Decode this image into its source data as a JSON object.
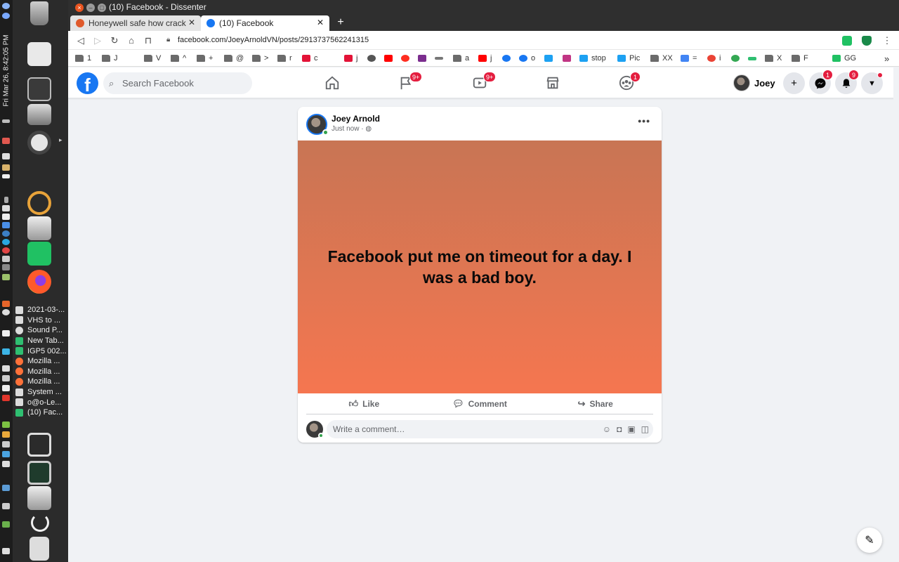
{
  "system": {
    "clock": "Fri Mar 26, 8:42:05 PM"
  },
  "dock": {
    "windows": [
      {
        "label": "2021-03-...",
        "color": "#d9d9d9"
      },
      {
        "label": "VHS to ...",
        "color": "#d9d9d9"
      },
      {
        "label": "Sound P...",
        "color": "#d9d9d9"
      },
      {
        "label": "New Tab...",
        "color": "#2fbf71"
      },
      {
        "label": "IGP5 002...",
        "color": "#2fbf71"
      },
      {
        "label": "Mozilla ...",
        "color": "#ff7139"
      },
      {
        "label": "Mozilla ...",
        "color": "#ff7139"
      },
      {
        "label": "Mozilla ...",
        "color": "#ff7139"
      },
      {
        "label": "System ...",
        "color": "#d9d9d9"
      },
      {
        "label": "o@o-Le...",
        "color": "#d9d9d9"
      },
      {
        "label": "(10) Fac...",
        "color": "#2fbf71"
      }
    ]
  },
  "browser": {
    "window_title": "(10) Facebook - Dissenter",
    "tabs": [
      {
        "label": "Honeywell safe how crack",
        "favicon_color": "#e05a2b"
      },
      {
        "label": "(10) Facebook",
        "favicon_color": "#1877f2"
      }
    ],
    "new_tab_label": "+",
    "url": "facebook.com/JoeyArnoldVN/posts/2913737562241315",
    "bookmarks": [
      {
        "label": "1",
        "icon": "folder"
      },
      {
        "label": "J",
        "icon": "folder"
      },
      {
        "label": "V",
        "icon": "folder"
      },
      {
        "label": "^",
        "icon": "folder"
      },
      {
        "label": "+",
        "icon": "folder"
      },
      {
        "label": "@",
        "icon": "folder"
      },
      {
        "label": ">",
        "icon": "folder"
      },
      {
        "label": "r",
        "icon": "folder"
      },
      {
        "label": "c",
        "icon": "hive"
      },
      {
        "label": "j",
        "icon": "hive"
      },
      {
        "label": "",
        "icon": "globe"
      },
      {
        "label": "",
        "icon": "youtube"
      },
      {
        "label": "",
        "icon": "brave"
      },
      {
        "label": "",
        "icon": "play"
      },
      {
        "label": "",
        "icon": "bar"
      },
      {
        "label": "a",
        "icon": "folder"
      },
      {
        "label": "j",
        "icon": "youtube"
      },
      {
        "label": "",
        "icon": "facebook"
      },
      {
        "label": "o",
        "icon": "facebook"
      },
      {
        "label": "",
        "icon": "twitter"
      },
      {
        "label": "",
        "icon": "instagram"
      },
      {
        "label": "stop",
        "icon": "twitter"
      },
      {
        "label": "Pic",
        "icon": "twitter"
      },
      {
        "label": "XX",
        "icon": "folder"
      },
      {
        "label": "=",
        "icon": "translate"
      },
      {
        "label": "i",
        "icon": "google"
      },
      {
        "label": "",
        "icon": "google"
      },
      {
        "label": "",
        "icon": "link"
      },
      {
        "label": "X",
        "icon": "folder"
      },
      {
        "label": "F",
        "icon": "folder"
      },
      {
        "label": "GG",
        "icon": "green"
      }
    ],
    "bookmarks_overflow": "»"
  },
  "facebook": {
    "search_placeholder": "Search Facebook",
    "nav_badges": {
      "pages": "9+",
      "watch": "9+",
      "groups": "1"
    },
    "profile_name": "Joey",
    "create_label": "+",
    "messenger_badge": "1",
    "notifications_badge": "9"
  },
  "post": {
    "author": "Joey Arnold",
    "time": "Just now · ",
    "privacy_icon": "globe-icon",
    "more_label": "•••",
    "text": "Facebook put me on timeout for a day. I was a bad boy.",
    "background_gradient": [
      "#c87554",
      "#f57650"
    ],
    "actions": {
      "like": "Like",
      "comment": "Comment",
      "share": "Share"
    },
    "comment_placeholder": "Write a comment…"
  },
  "colors": {
    "facebook_blue": "#1877f2",
    "badge_red": "#e41e3f",
    "page_background": "#f0f2f5"
  }
}
